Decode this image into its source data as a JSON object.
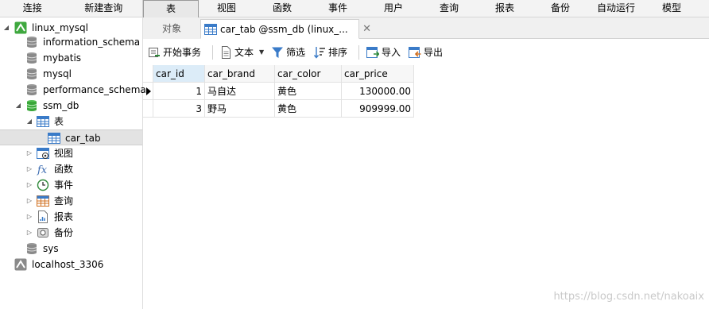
{
  "menu": {
    "left": [
      "连接",
      "新建查询"
    ],
    "right": [
      "表",
      "视图",
      "函数",
      "事件",
      "用户",
      "查询",
      "报表",
      "备份",
      "自动运行",
      "模型"
    ],
    "active": "表"
  },
  "tree": {
    "connection": "linux_mysql",
    "databases": [
      "information_schema",
      "mybatis",
      "mysql",
      "performance_schema",
      "ssm_db"
    ],
    "open_db": "ssm_db",
    "tables_group": "表",
    "table": "car_tab",
    "groups": [
      "视图",
      "函数",
      "事件",
      "查询",
      "报表",
      "备份"
    ],
    "after": [
      "sys"
    ],
    "other_connection": "localhost_3306"
  },
  "tabs": {
    "objects": "对象",
    "current": "car_tab @ssm_db (linux_..."
  },
  "toolbar": {
    "begin_tx": "开始事务",
    "text": "文本",
    "filter": "筛选",
    "sort": "排序",
    "import": "导入",
    "export": "导出"
  },
  "grid": {
    "columns": [
      "car_id",
      "car_brand",
      "car_color",
      "car_price"
    ],
    "rows": [
      [
        "1",
        "马自达",
        "黄色",
        "130000.00"
      ],
      [
        "3",
        "野马",
        "黄色",
        "909999.00"
      ]
    ]
  },
  "watermark": "https://blog.csdn.net/nakoaix"
}
